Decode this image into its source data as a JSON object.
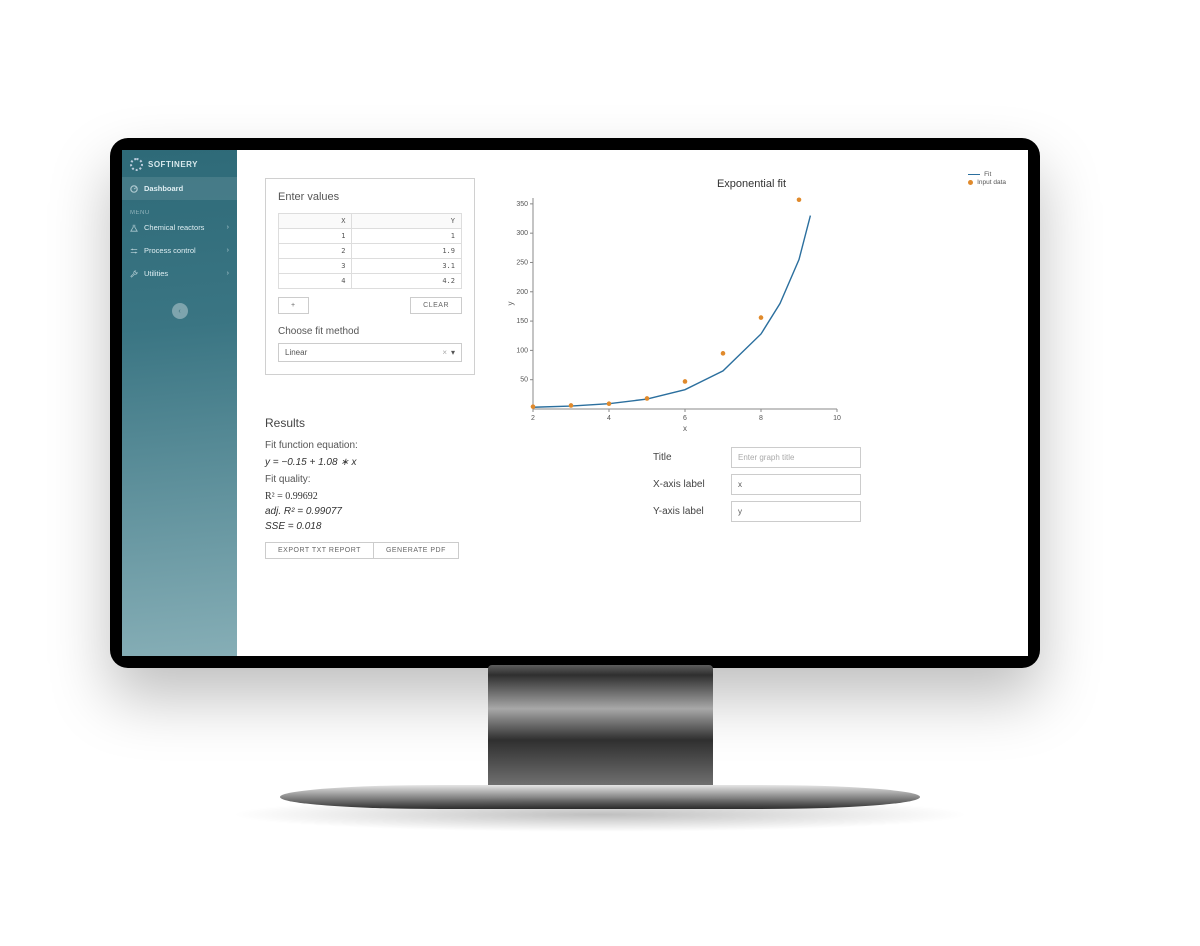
{
  "brand": "SOFTINERY",
  "sidebar": {
    "dashboard": "Dashboard",
    "group": "MENU",
    "items": [
      {
        "label": "Chemical reactors"
      },
      {
        "label": "Process control"
      },
      {
        "label": "Utilities"
      }
    ]
  },
  "panel": {
    "title": "Enter values",
    "col_x": "X",
    "col_y": "Y",
    "rows": [
      {
        "x": "1",
        "y": "1"
      },
      {
        "x": "2",
        "y": "1.9"
      },
      {
        "x": "3",
        "y": "3.1"
      },
      {
        "x": "4",
        "y": "4.2"
      }
    ],
    "add": "+",
    "clear": "CLEAR",
    "fit_label": "Choose fit method",
    "fit_value": "Linear"
  },
  "results": {
    "title": "Results",
    "eq_label": "Fit function equation:",
    "eq": "y = −0.15 + 1.08 ∗ x",
    "q_label": "Fit quality:",
    "r2": "R² = 0.99692",
    "adjr2": "adj. R² = 0.99077",
    "sse": "SSE = 0.018",
    "btn_txt": "EXPORT TXT REPORT",
    "btn_pdf": "GENERATE PDF"
  },
  "chart": {
    "title": "Exponential fit",
    "legend_fit": "Fit",
    "legend_data": "Input data",
    "xlabel": "x",
    "ylabel": "y",
    "title_label": "Title",
    "title_placeholder": "Enter graph title",
    "xaxis_label": "X-axis label",
    "yaxis_label": "Y-axis label",
    "xaxis_value": "x",
    "yaxis_value": "y"
  },
  "chart_data": {
    "type": "scatter+line",
    "title": "Exponential fit",
    "xlabel": "x",
    "ylabel": "y",
    "xlim": [
      2,
      10
    ],
    "ylim": [
      0,
      360
    ],
    "xticks": [
      2,
      4,
      6,
      8,
      10
    ],
    "yticks": [
      50,
      100,
      150,
      200,
      250,
      300,
      350
    ],
    "series": [
      {
        "name": "Input data",
        "type": "scatter",
        "x": [
          2,
          3,
          4,
          5,
          6,
          7,
          8,
          9
        ],
        "y": [
          4,
          6,
          9,
          18,
          47,
          95,
          156,
          357
        ]
      },
      {
        "name": "Fit",
        "type": "line",
        "x": [
          2,
          3,
          4,
          5,
          6,
          7,
          8,
          8.5,
          9,
          9.3
        ],
        "y": [
          3,
          5,
          9,
          17,
          33,
          65,
          128,
          180,
          255,
          330
        ]
      }
    ]
  }
}
